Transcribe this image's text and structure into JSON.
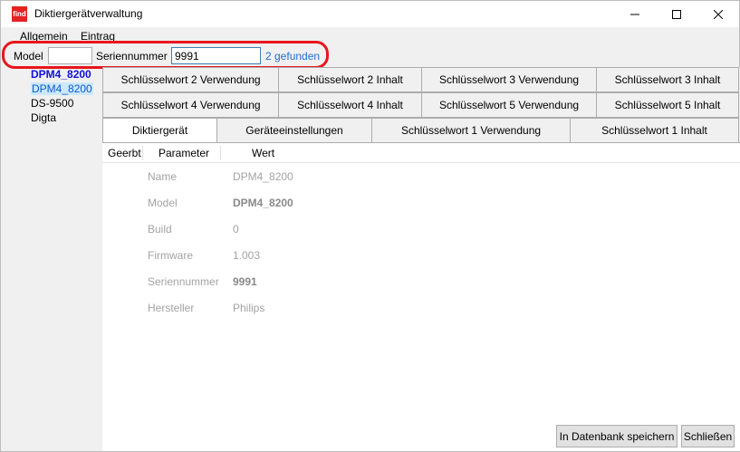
{
  "window": {
    "icon_text": "find",
    "title": "Diktiergerätverwaltung"
  },
  "menu": [
    "Allgemein",
    "Eintrag"
  ],
  "search": {
    "model_label": "Model",
    "model_value": "",
    "serial_label": "Seriennummer",
    "serial_value": "9991",
    "result": "2 gefunden"
  },
  "devices": {
    "group_header": "DPM4_8200",
    "items": [
      "DPM4_8200",
      "DS-9500",
      "Digta"
    ],
    "selected": "DPM4_8200"
  },
  "tabs": {
    "row1": [
      "Schlüsselwort 2 Verwendung",
      "Schlüsselwort 2 Inhalt",
      "Schlüsselwort 3 Verwendung",
      "Schlüsselwort 3 Inhalt"
    ],
    "row2": [
      "Schlüsselwort 4 Verwendung",
      "Schlüsselwort 4 Inhalt",
      "Schlüsselwort 5 Verwendung",
      "Schlüsselwort 5 Inhalt"
    ],
    "row3": [
      "Diktiergerät",
      "Geräteeinstellungen",
      "Schlüsselwort 1 Verwendung",
      "Schlüsselwort 1 Inhalt"
    ],
    "active": "Diktiergerät"
  },
  "grid": {
    "headers": [
      "Geerbt",
      "Parameter",
      "Wert"
    ],
    "rows": [
      {
        "parameter": "Name",
        "value": "DPM4_8200",
        "bold": false
      },
      {
        "parameter": "Model",
        "value": "DPM4_8200",
        "bold": true
      },
      {
        "parameter": "Build",
        "value": "0",
        "bold": false
      },
      {
        "parameter": "Firmware",
        "value": "1.003",
        "bold": false
      },
      {
        "parameter": "Seriennummer",
        "value": "9991",
        "bold": true
      },
      {
        "parameter": "Hersteller",
        "value": "Philips",
        "bold": false
      }
    ]
  },
  "buttons": {
    "save": "In Datenbank speichern",
    "close": "Schließen"
  },
  "colors": {
    "highlight_ring": "#e8161d",
    "link_blue": "#1f6fd1",
    "device_header_blue": "#1010e0",
    "selection_bg": "#cce8ff"
  }
}
